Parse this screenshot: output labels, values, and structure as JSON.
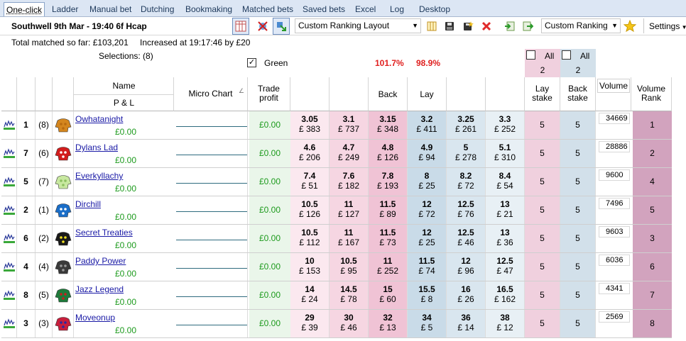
{
  "tabs": [
    {
      "label": "One-click",
      "active": true
    },
    {
      "label": "Ladder"
    },
    {
      "label": "Manual bet"
    },
    {
      "label": "Dutching"
    },
    {
      "label": "Bookmaking"
    },
    {
      "label": "Matched bets"
    },
    {
      "label": "Saved bets"
    },
    {
      "label": "Excel"
    },
    {
      "label": "Log"
    },
    {
      "label": "Desktop"
    }
  ],
  "toolbar": {
    "market_title": "Southwell 9th Mar - 19:40 6f Hcap",
    "layout_select": "Custom Ranking Layout",
    "ranking_select": "Custom Ranking",
    "settings_label": "Settings"
  },
  "info": {
    "total_matched": "Total matched so far: £103,201",
    "increased": "Increased at 19:17:46 by £20",
    "selections": "Selections: (8)",
    "green_label": "Green",
    "back_book": "101.7%",
    "lay_book": "98.9%",
    "lay_all_label": "All",
    "lay_all_value": "2",
    "back_all_label": "All",
    "back_all_value": "2"
  },
  "headers": {
    "name": "Name",
    "pl": "P & L",
    "micro_chart": "Micro Chart",
    "trade_profit": "Trade profit",
    "back": "Back",
    "lay": "Lay",
    "lay_stake": "Lay stake",
    "back_stake": "Back stake",
    "volume": "Volume",
    "volume_rank": "Volume Rank"
  },
  "colors": {
    "back_light": "#fbe8ef",
    "back_mid": "#f6d6e2",
    "back_best": "#f0c3d5",
    "lay_best": "#c9dbe8",
    "lay_mid": "#d9e6ef",
    "lay_light": "#e8f0f5",
    "lay_stake_bg": "#f0d0de",
    "back_stake_bg": "#d2e0ea",
    "rank_bg": "#d2a3be",
    "pl_green": "#1c9a1c",
    "book_red": "#e0201f"
  },
  "runners": [
    {
      "num": "1",
      "draw": "(8)",
      "name": "Owhatanight",
      "pl": "£0.00",
      "trade": "£0.00",
      "silk": "#d4861e",
      "silk2": "#b86a10",
      "prices": [
        {
          "p": "3.05",
          "v": "£ 383"
        },
        {
          "p": "3.1",
          "v": "£ 737"
        },
        {
          "p": "3.15",
          "v": "£ 348"
        },
        {
          "p": "3.2",
          "v": "£ 411"
        },
        {
          "p": "3.25",
          "v": "£ 261"
        },
        {
          "p": "3.3",
          "v": "£ 252"
        }
      ],
      "lay_stake": "5",
      "back_stake": "5",
      "volume": "34669",
      "rank": "1"
    },
    {
      "num": "7",
      "draw": "(6)",
      "name": "Dylans Lad",
      "pl": "£0.00",
      "trade": "£0.00",
      "silk": "#d21c1c",
      "silk2": "#ffffff",
      "prices": [
        {
          "p": "4.6",
          "v": "£ 206"
        },
        {
          "p": "4.7",
          "v": "£ 249"
        },
        {
          "p": "4.8",
          "v": "£ 126"
        },
        {
          "p": "4.9",
          "v": "£ 94"
        },
        {
          "p": "5",
          "v": "£ 278"
        },
        {
          "p": "5.1",
          "v": "£ 310"
        }
      ],
      "lay_stake": "5",
      "back_stake": "5",
      "volume": "28886",
      "rank": "2"
    },
    {
      "num": "5",
      "draw": "(7)",
      "name": "Everkyllachy",
      "pl": "£0.00",
      "trade": "£0.00",
      "silk": "#c8e8a0",
      "silk2": "#8cc060",
      "prices": [
        {
          "p": "7.4",
          "v": "£ 51"
        },
        {
          "p": "7.6",
          "v": "£ 182"
        },
        {
          "p": "7.8",
          "v": "£ 193"
        },
        {
          "p": "8",
          "v": "£ 25"
        },
        {
          "p": "8.2",
          "v": "£ 72"
        },
        {
          "p": "8.4",
          "v": "£ 54"
        }
      ],
      "lay_stake": "5",
      "back_stake": "5",
      "volume": "9600",
      "rank": "4"
    },
    {
      "num": "2",
      "draw": "(1)",
      "name": "Dirchill",
      "pl": "£0.00",
      "trade": "£0.00",
      "silk": "#1a6ec8",
      "silk2": "#ffffff",
      "prices": [
        {
          "p": "10.5",
          "v": "£ 126"
        },
        {
          "p": "11",
          "v": "£ 127"
        },
        {
          "p": "11.5",
          "v": "£ 89"
        },
        {
          "p": "12",
          "v": "£ 72"
        },
        {
          "p": "12.5",
          "v": "£ 76"
        },
        {
          "p": "13",
          "v": "£ 21"
        }
      ],
      "lay_stake": "5",
      "back_stake": "5",
      "volume": "7496",
      "rank": "5"
    },
    {
      "num": "6",
      "draw": "(2)",
      "name": "Secret Treaties",
      "pl": "£0.00",
      "trade": "£0.00",
      "silk": "#1a1a1a",
      "silk2": "#f0e020",
      "prices": [
        {
          "p": "10.5",
          "v": "£ 112"
        },
        {
          "p": "11",
          "v": "£ 167"
        },
        {
          "p": "11.5",
          "v": "£ 73"
        },
        {
          "p": "12",
          "v": "£ 25"
        },
        {
          "p": "12.5",
          "v": "£ 46"
        },
        {
          "p": "13",
          "v": "£ 36"
        }
      ],
      "lay_stake": "5",
      "back_stake": "5",
      "volume": "9603",
      "rank": "3"
    },
    {
      "num": "4",
      "draw": "(4)",
      "name": "Paddy Power",
      "pl": "£0.00",
      "trade": "£0.00",
      "silk": "#3a3a3a",
      "silk2": "#9a9a9a",
      "prices": [
        {
          "p": "10",
          "v": "£ 153"
        },
        {
          "p": "10.5",
          "v": "£ 95"
        },
        {
          "p": "11",
          "v": "£ 252"
        },
        {
          "p": "11.5",
          "v": "£ 74"
        },
        {
          "p": "12",
          "v": "£ 96"
        },
        {
          "p": "12.5",
          "v": "£ 47"
        }
      ],
      "lay_stake": "5",
      "back_stake": "5",
      "volume": "6036",
      "rank": "6"
    },
    {
      "num": "8",
      "draw": "(5)",
      "name": "Jazz Legend",
      "pl": "£0.00",
      "trade": "£0.00",
      "silk": "#1e7a3a",
      "silk2": "#c81e1e",
      "prices": [
        {
          "p": "14",
          "v": "£ 24"
        },
        {
          "p": "14.5",
          "v": "£ 78"
        },
        {
          "p": "15",
          "v": "£ 60"
        },
        {
          "p": "15.5",
          "v": "£ 8"
        },
        {
          "p": "16",
          "v": "£ 26"
        },
        {
          "p": "16.5",
          "v": "£ 162"
        }
      ],
      "lay_stake": "5",
      "back_stake": "5",
      "volume": "4341",
      "rank": "7"
    },
    {
      "num": "3",
      "draw": "(3)",
      "name": "Moveonup",
      "pl": "£0.00",
      "trade": "£0.00",
      "silk": "#c81e3c",
      "silk2": "#2a2aa0",
      "prices": [
        {
          "p": "29",
          "v": "£ 39"
        },
        {
          "p": "30",
          "v": "£ 46"
        },
        {
          "p": "32",
          "v": "£ 13"
        },
        {
          "p": "34",
          "v": "£ 5"
        },
        {
          "p": "36",
          "v": "£ 14"
        },
        {
          "p": "38",
          "v": "£ 12"
        }
      ],
      "lay_stake": "5",
      "back_stake": "5",
      "volume": "2569",
      "rank": "8"
    }
  ]
}
